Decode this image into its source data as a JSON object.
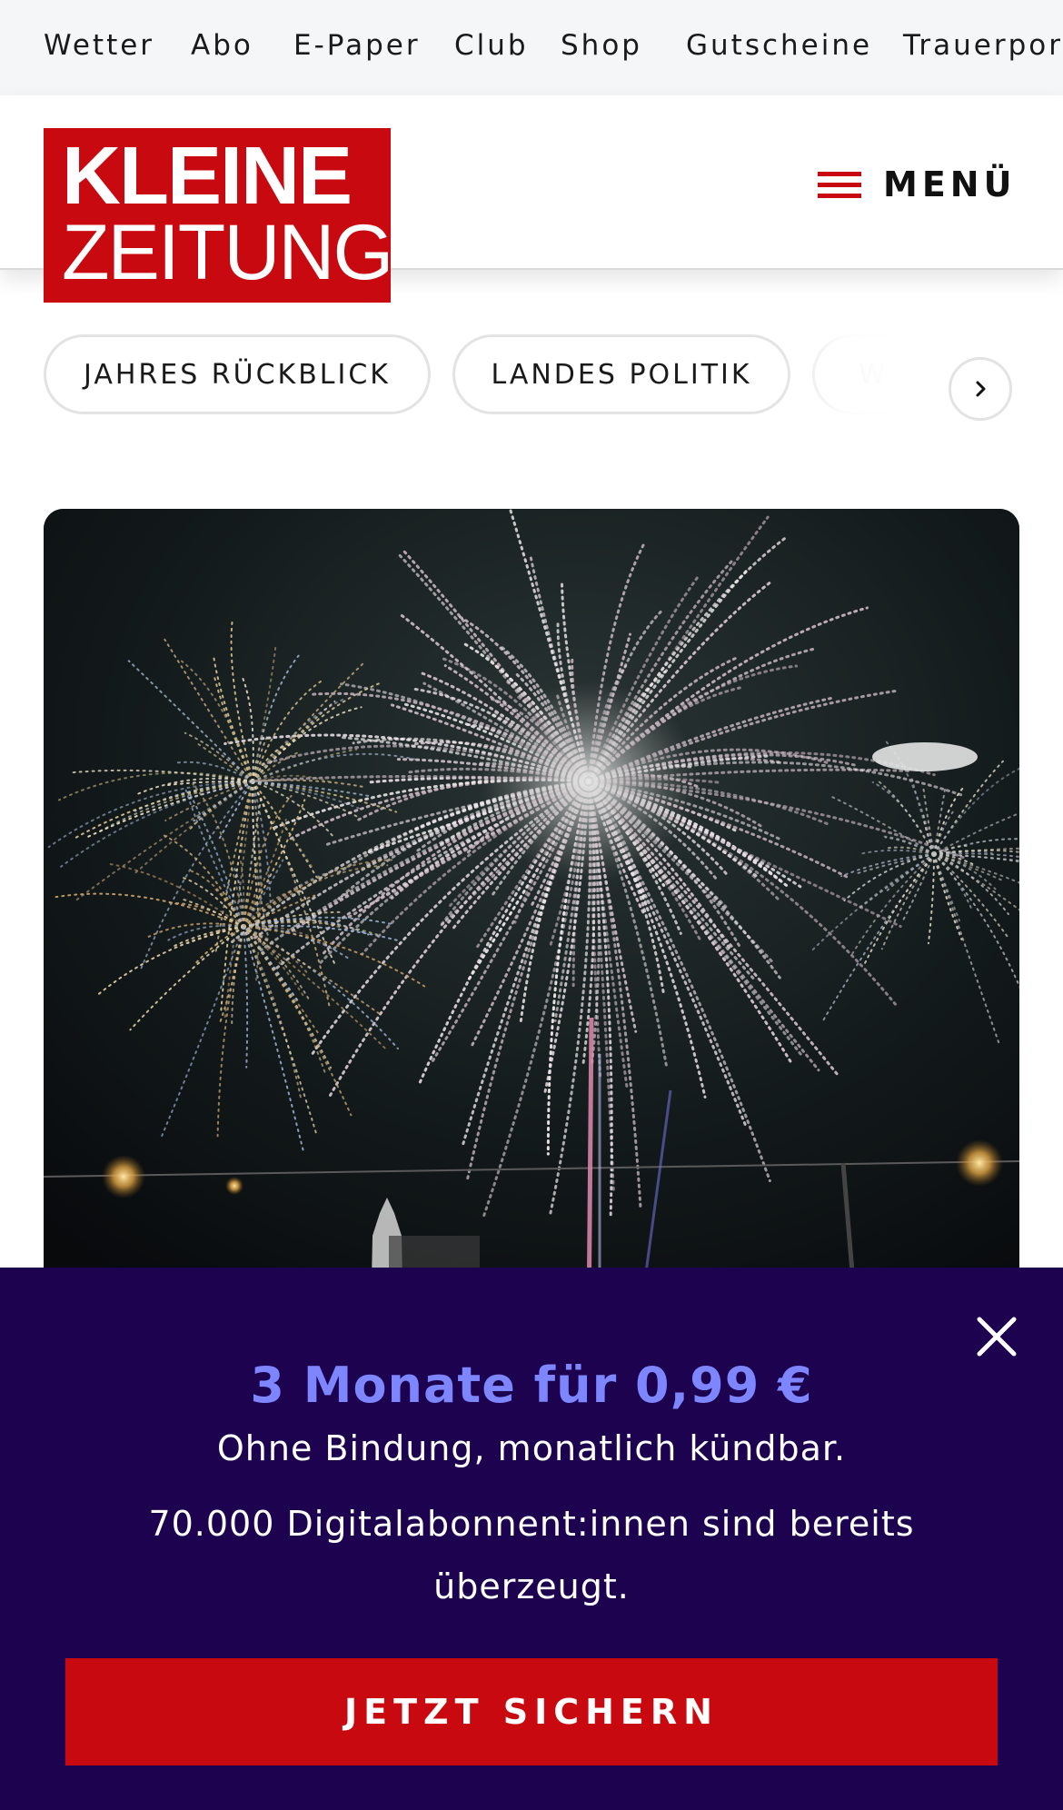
{
  "top_nav": {
    "links": [
      "Wetter",
      "Abo",
      "E-Paper",
      "Club",
      "Shop",
      "Gutscheine",
      "Trauerportal"
    ]
  },
  "header": {
    "logo_line1": "KLEINE",
    "logo_line2": "ZEITUNG",
    "menu_label": "MENÜ",
    "brand_color": "#c8090f"
  },
  "categories": {
    "chips": [
      "JAHRES RÜCKBLICK",
      "LANDES POLITIK",
      "WE"
    ],
    "next_icon": "chevron-right-icon"
  },
  "hero": {
    "image": "fireworks-night-sky"
  },
  "paywall": {
    "headline": "3 Monate für 0,99 €",
    "subline": "Ohne Bindung, monatlich kündbar.",
    "body": "70.000 Digitalabonnent:innen sind bereits überzeugt.",
    "cta_label": "JETZT SICHERN",
    "close_icon": "close-icon",
    "background": "#1d034f",
    "headline_color": "#7d86ff"
  }
}
